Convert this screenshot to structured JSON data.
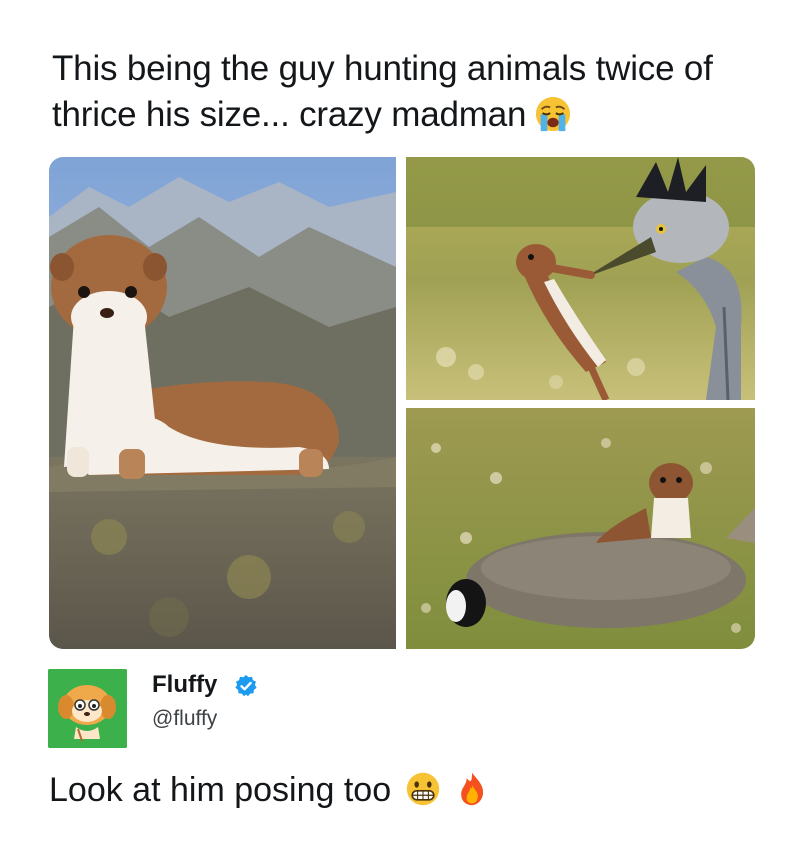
{
  "meme": {
    "caption": "This being the guy hunting animals twice of thrice his size... crazy madman",
    "caption_emoji": "crying-face-emoji"
  },
  "images": [
    {
      "id": "weasel-on-rock"
    },
    {
      "id": "weasel-vs-heron"
    },
    {
      "id": "weasel-on-rabbit"
    }
  ],
  "post": {
    "author_name": "Fluffy",
    "handle": "@fluffy",
    "verified_icon": "verified-badge-icon",
    "avatar_color": "#3cb04a",
    "text": "Look at him posing too",
    "emojis": [
      "grimacing-face-emoji",
      "fire-emoji"
    ]
  }
}
